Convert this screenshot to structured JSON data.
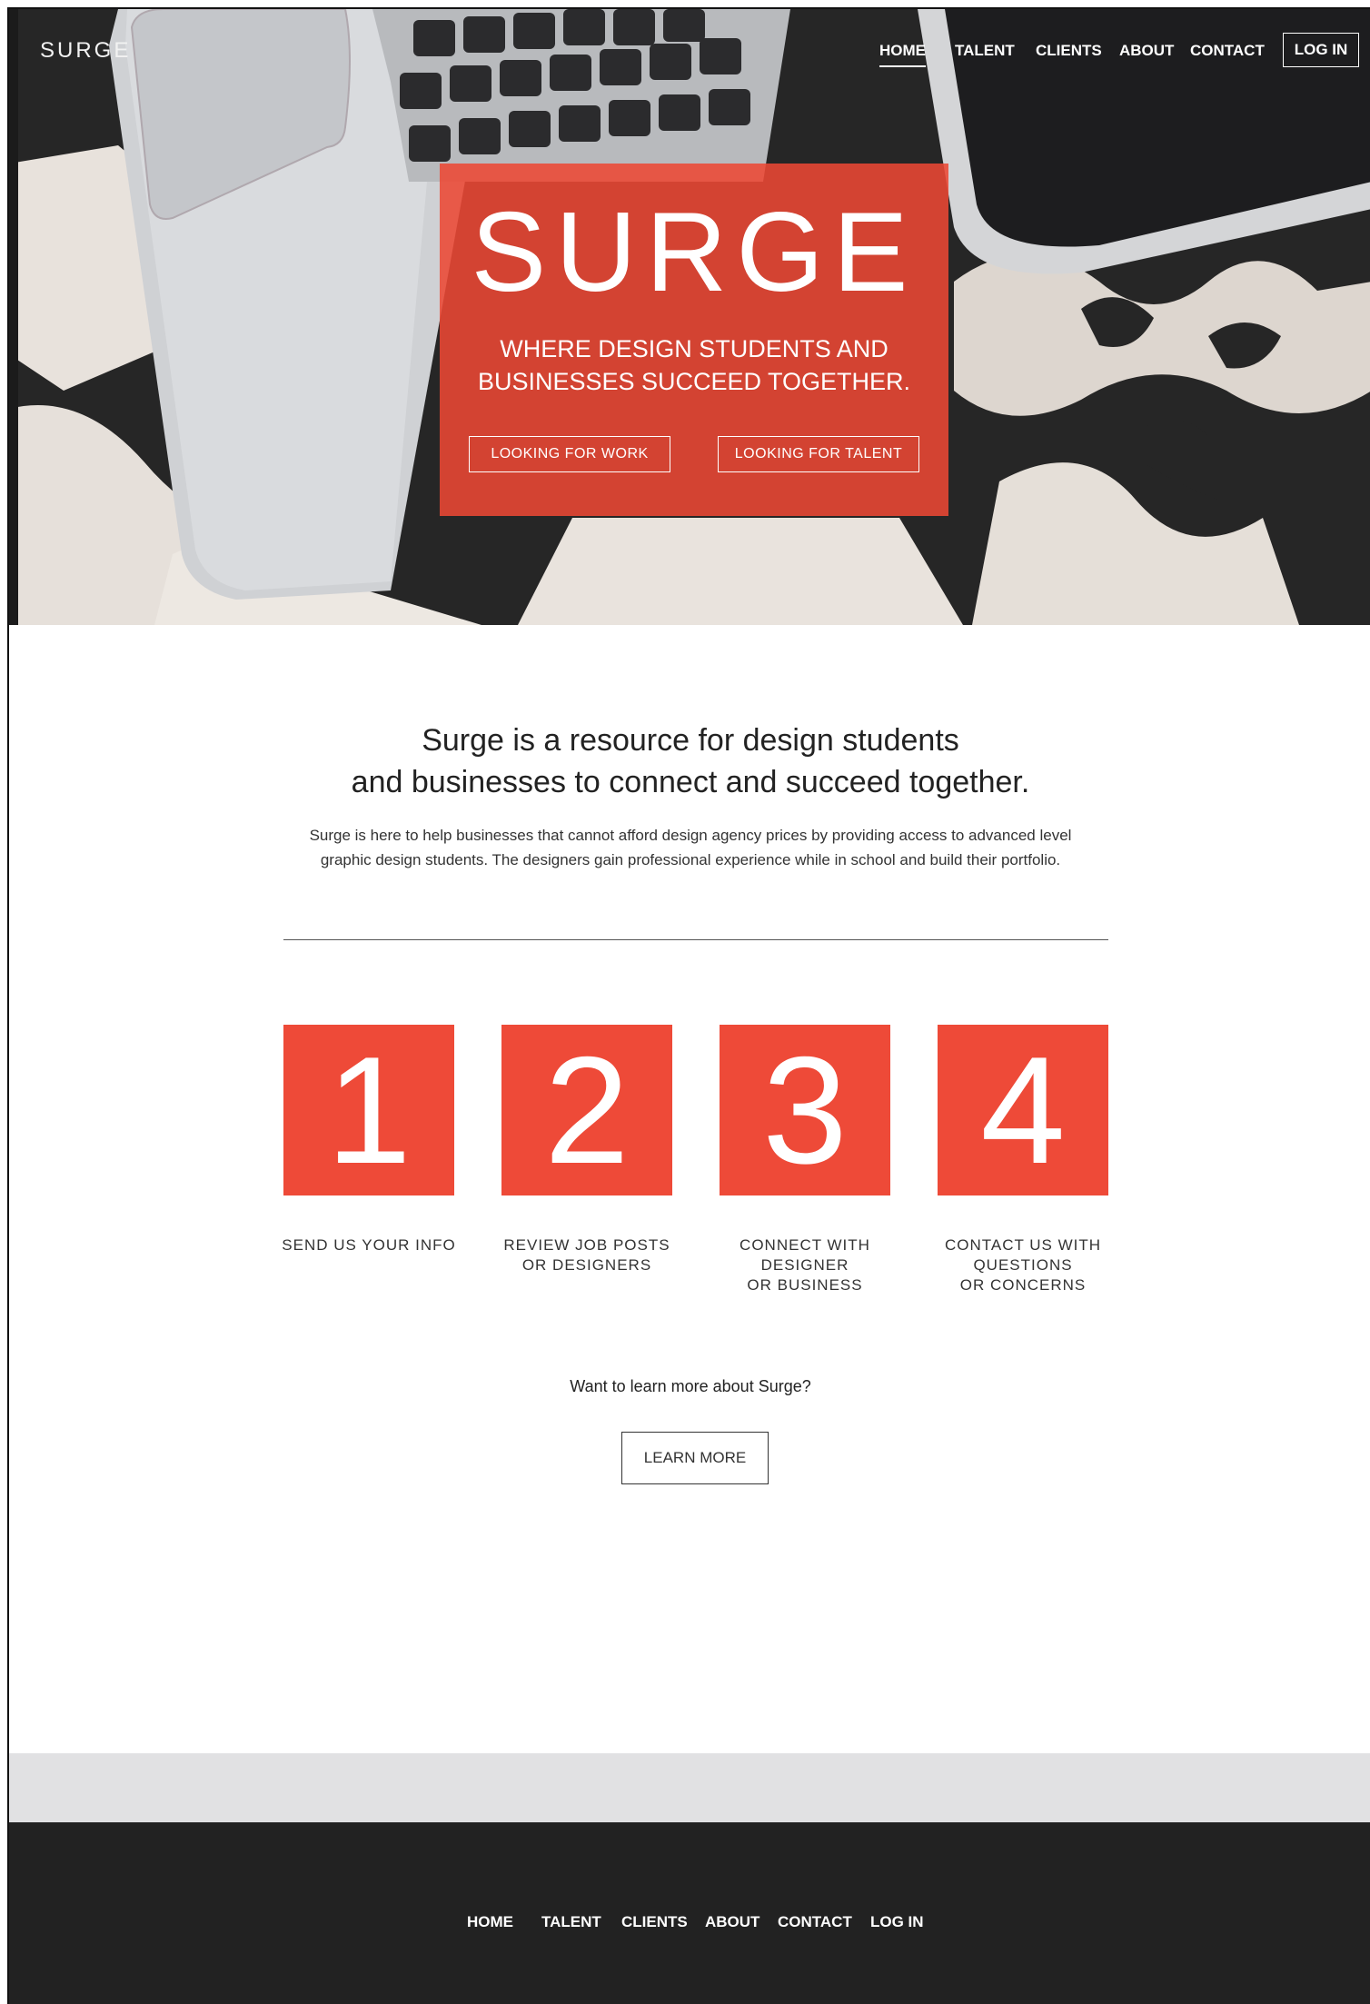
{
  "brand": "SURGE",
  "nav": {
    "items": [
      "HOME",
      "TALENT",
      "CLIENTS",
      "ABOUT",
      "CONTACT"
    ],
    "active": "HOME",
    "login": "LOG IN"
  },
  "hero": {
    "title": "SURGE",
    "subtitle_line1": "WHERE DESIGN STUDENTS AND",
    "subtitle_line2": "BUSINESSES SUCCEED TOGETHER.",
    "work_button": "LOOKING FOR WORK",
    "talent_button": "LOOKING FOR TALENT"
  },
  "intro": {
    "heading_line1": "Surge is a resource for design students",
    "heading_line2": "and businesses to connect and succeed together.",
    "body_line1": "Surge is here to help businesses that cannot afford design agency prices by providing access to advanced level",
    "body_line2": "graphic design students. The designers gain professional experience while in school and build their portfolio."
  },
  "steps": [
    {
      "number": "1",
      "lines": [
        "SEND US YOUR INFO"
      ]
    },
    {
      "number": "2",
      "lines": [
        "REVIEW JOB POSTS",
        "OR DESIGNERS"
      ]
    },
    {
      "number": "3",
      "lines": [
        "CONNECT WITH",
        "DESIGNER",
        "OR BUSINESS"
      ]
    },
    {
      "number": "4",
      "lines": [
        "CONTACT US WITH",
        "QUESTIONS",
        "OR CONCERNS"
      ]
    }
  ],
  "learn_more": {
    "question": "Want to learn more about Surge?",
    "button": "LEARN MORE"
  },
  "footer": {
    "items": [
      "HOME",
      "TALENT",
      "CLIENTS",
      "ABOUT",
      "CONTACT",
      "LOG IN"
    ]
  },
  "colors": {
    "accent": "#ee4a38",
    "footer_bg": "#222222",
    "band_bg": "#e1e1e3"
  }
}
